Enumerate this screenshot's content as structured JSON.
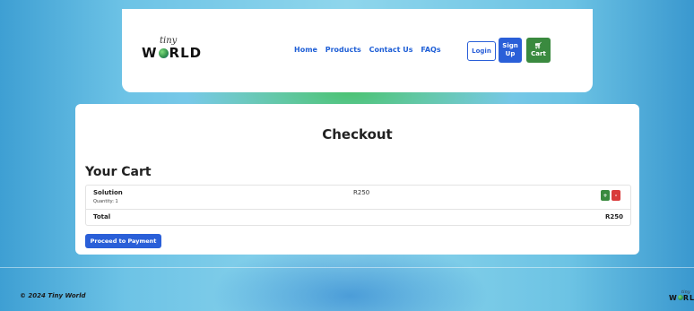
{
  "nav": {
    "logo_small": "tiny",
    "logo_big_pre": "W",
    "logo_big_post": "RLD",
    "links": [
      "Home",
      "Products",
      "Contact Us",
      "FAQs"
    ],
    "login": "Login",
    "signup_line1": "Sign",
    "signup_line2": "Up",
    "cart_icon": "cart-icon",
    "cart": "Cart"
  },
  "checkout": {
    "title": "Checkout",
    "cart_heading": "Your Cart",
    "items": [
      {
        "name": "Solution",
        "quantity": "Quantity: 1",
        "price": "R250",
        "plus": "+",
        "minus": "-"
      }
    ],
    "total_label": "Total",
    "total_value": "R250",
    "proceed_button": "Proceed to Payment"
  },
  "footer": {
    "copyright": "© 2024 Tiny World",
    "logo_small": "tiny",
    "logo_big_pre": "W",
    "logo_big_post": "RL"
  },
  "colors": {
    "primary": "#2a5fd8",
    "success": "#3a8a3f",
    "danger": "#d93a3a"
  }
}
